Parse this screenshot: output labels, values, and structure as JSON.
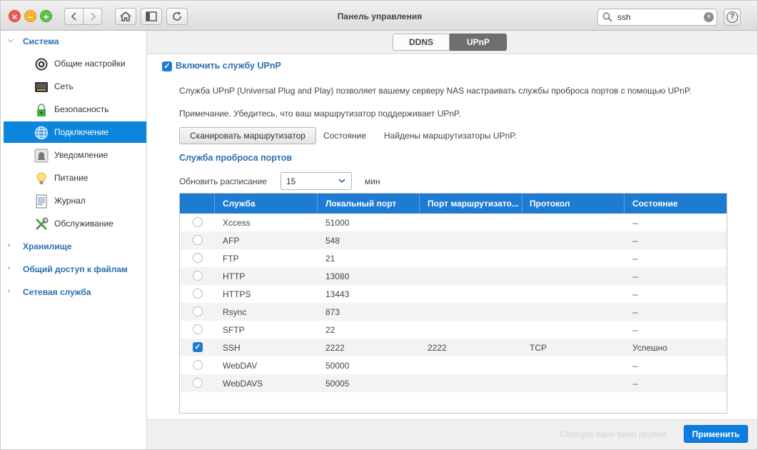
{
  "window": {
    "title": "Панель управления"
  },
  "search": {
    "value": "ssh"
  },
  "sidebar": {
    "groups": [
      {
        "label": "Система"
      },
      {
        "label": "Хранилище"
      },
      {
        "label": "Общий доступ к файлам"
      },
      {
        "label": "Сетевая служба"
      }
    ],
    "items": [
      {
        "label": "Общие настройки",
        "icon": "gear-icon"
      },
      {
        "label": "Сеть",
        "icon": "network-icon"
      },
      {
        "label": "Безопасность",
        "icon": "lock-icon"
      },
      {
        "label": "Подключение",
        "icon": "globe-icon",
        "active": true
      },
      {
        "label": "Уведомление",
        "icon": "bell-icon"
      },
      {
        "label": "Питание",
        "icon": "bulb-icon"
      },
      {
        "label": "Журнал",
        "icon": "log-icon"
      },
      {
        "label": "Обслуживание",
        "icon": "tools-icon"
      }
    ]
  },
  "tabs": [
    {
      "label": "DDNS"
    },
    {
      "label": "UPnP",
      "active": true
    }
  ],
  "upnp": {
    "enable_label": "Включить службу UPnP",
    "enabled": true,
    "description": "Служба UPnP (Universal Plug and Play) позволяет вашему серверу NAS настраивать службы проброса портов с помощью UPnP.",
    "note": "Примечание. Убедитесь, что ваш маршрутизатор поддерживает UPnP.",
    "scan_button": "Сканировать маршрутизатор",
    "status_label": "Состояние",
    "status_sep": ":",
    "status_value": "Найдены маршрутизаторы UPnP.",
    "port_forward_title": "Служба проброса портов",
    "schedule_label": "Обновить расписание",
    "schedule_value": "15",
    "schedule_unit": "мин"
  },
  "table": {
    "headers": [
      "Служба",
      "Локальный порт",
      "Порт маршрутизато...",
      "Протокол",
      "Состояние"
    ],
    "rows": [
      {
        "checked": false,
        "service": "Xccess",
        "local_port": "51000",
        "router_port": "",
        "protocol": "",
        "status": "--"
      },
      {
        "checked": false,
        "service": "AFP",
        "local_port": "548",
        "router_port": "",
        "protocol": "",
        "status": "--"
      },
      {
        "checked": false,
        "service": "FTP",
        "local_port": "21",
        "router_port": "",
        "protocol": "",
        "status": "--"
      },
      {
        "checked": false,
        "service": "HTTP",
        "local_port": "13080",
        "router_port": "",
        "protocol": "",
        "status": "--"
      },
      {
        "checked": false,
        "service": "HTTPS",
        "local_port": "13443",
        "router_port": "",
        "protocol": "",
        "status": "--"
      },
      {
        "checked": false,
        "service": "Rsync",
        "local_port": "873",
        "router_port": "",
        "protocol": "",
        "status": "--"
      },
      {
        "checked": false,
        "service": "SFTP",
        "local_port": "22",
        "router_port": "",
        "protocol": "",
        "status": "--"
      },
      {
        "checked": true,
        "service": "SSH",
        "local_port": "2222",
        "router_port": "2222",
        "protocol": "TCP",
        "status": "Успешно"
      },
      {
        "checked": false,
        "service": "WebDAV",
        "local_port": "50000",
        "router_port": "",
        "protocol": "",
        "status": "--"
      },
      {
        "checked": false,
        "service": "WebDAVS",
        "local_port": "50005",
        "router_port": "",
        "protocol": "",
        "status": "--"
      }
    ]
  },
  "footer": {
    "applied_text": "Changes have been applied.",
    "apply_button": "Применить"
  },
  "colors": {
    "accent": "#1d7bd1",
    "active_item": "#0c86dc",
    "group_text": "#2a6fb2"
  }
}
